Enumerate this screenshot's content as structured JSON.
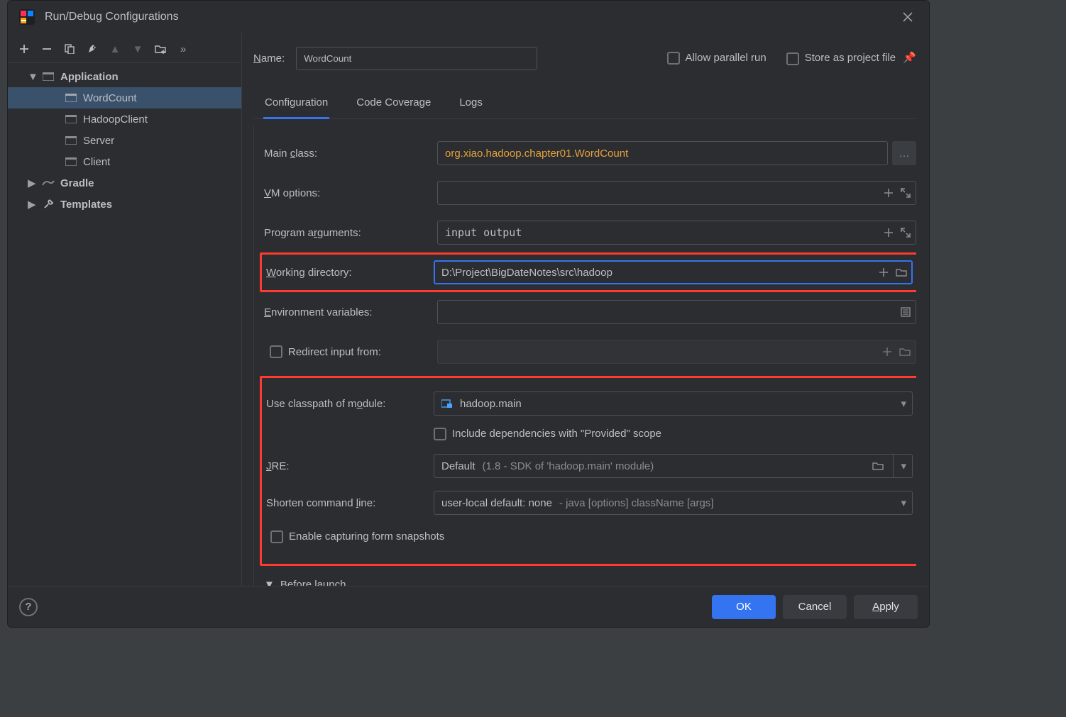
{
  "title": "Run/Debug Configurations",
  "toolbar": {
    "add": "+",
    "remove": "−",
    "copy": "copy",
    "wrench": "wrench",
    "up": "▲",
    "down": "▼",
    "folder": "folder",
    "more": "»"
  },
  "tree": {
    "application": "Application",
    "wordcount": "WordCount",
    "hadoopclient": "HadoopClient",
    "server": "Server",
    "client": "Client",
    "gradle": "Gradle",
    "templates": "Templates"
  },
  "top": {
    "name_label_pre": "N",
    "name_label_post": "ame:",
    "name_value": "WordCount",
    "allow_parallel": "Allow parallel run",
    "store_pre": "S",
    "store_post": "tore as project file"
  },
  "tabs": {
    "configuration": "Configuration",
    "code_coverage": "Code Coverage",
    "logs": "Logs"
  },
  "fields": {
    "main_class_pre": "Main ",
    "main_class_ul": "c",
    "main_class_post": "lass:",
    "main_class_value": "org.xiao.hadoop.chapter01.WordCount",
    "vm_ul": "V",
    "vm_post": "M options:",
    "vm_value": "",
    "args_pre": "Program a",
    "args_ul": "r",
    "args_post": "guments:",
    "args_value": "input output",
    "wd_ul": "W",
    "wd_post": "orking directory:",
    "wd_value": "D:\\Project\\BigDateNotes\\src\\hadoop",
    "env_ul": "E",
    "env_post": "nvironment variables:",
    "env_value": "",
    "redirect_label": "Redirect input from:",
    "classpath_pre": "Use classpath of m",
    "classpath_ul": "o",
    "classpath_post": "dule:",
    "classpath_value": "hadoop.main",
    "include_provided": "Include dependencies with \"Provided\" scope",
    "jre_ul": "J",
    "jre_post": "RE:",
    "jre_value": "Default",
    "jre_hint": " (1.8 - SDK of 'hadoop.main' module)",
    "shorten_pre": "Shorten command ",
    "shorten_ul": "l",
    "shorten_post": "ine:",
    "shorten_value": "user-local default: none",
    "shorten_hint": " - java [options] className [args]",
    "enable_pre": "E",
    "enable_ul": "n",
    "enable_post": "able capturing form snapshots",
    "before_launch_ul": "B",
    "before_launch_post": "efore launch"
  },
  "buttons": {
    "ok": "OK",
    "cancel": "Cancel",
    "apply_ul": "A",
    "apply_post": "pply"
  },
  "help": "?"
}
